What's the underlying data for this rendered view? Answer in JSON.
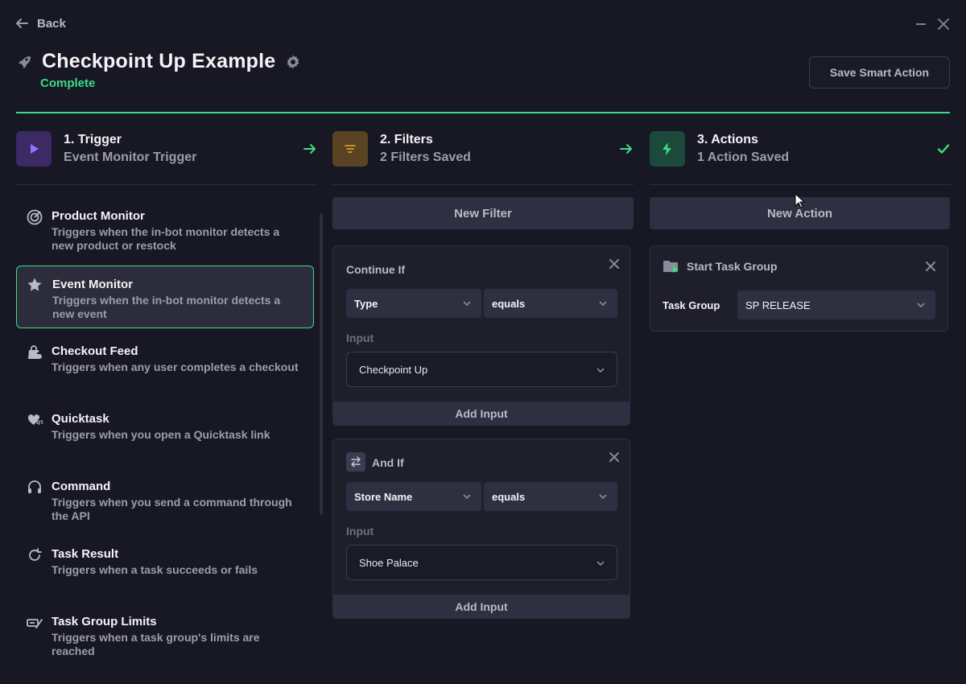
{
  "window": {
    "back_label": "Back",
    "title": "Checkpoint Up Example",
    "status": "Complete",
    "save_label": "Save Smart Action"
  },
  "colors": {
    "accent": "#3ddc84",
    "trigger": "#3b2a63",
    "filters": "#5a4322",
    "actions": "#1b4a3a"
  },
  "steps": [
    {
      "title": "1. Trigger",
      "subtitle": "Event Monitor Trigger",
      "icon": "play-icon"
    },
    {
      "title": "2. Filters",
      "subtitle": "2 Filters Saved",
      "icon": "filter-icon"
    },
    {
      "title": "3. Actions",
      "subtitle": "1 Action Saved",
      "icon": "bolt-icon"
    }
  ],
  "triggers": [
    {
      "title": "Product Monitor",
      "desc": "Triggers when the in-bot monitor detects a new product or restock",
      "icon": "target-icon"
    },
    {
      "title": "Event Monitor",
      "desc": "Triggers when the in-bot monitor detects a new event",
      "icon": "star-icon"
    },
    {
      "title": "Checkout Feed",
      "desc": "Triggers when any user completes a checkout",
      "icon": "bag-icon"
    },
    {
      "title": "Quicktask",
      "desc": "Triggers when you open a Quicktask link",
      "icon": "quicktask-icon"
    },
    {
      "title": "Command",
      "desc": "Triggers when you send a command through the API",
      "icon": "headset-icon"
    },
    {
      "title": "Task Result",
      "desc": "Triggers when a task succeeds or fails",
      "icon": "refresh-icon"
    },
    {
      "title": "Task Group Limits",
      "desc": "Triggers when a task group's limits are reached",
      "icon": "limits-icon"
    }
  ],
  "filters": {
    "new_filter_label": "New Filter",
    "cards": [
      {
        "heading": "Continue If",
        "field": "Type",
        "operator": "equals",
        "input_label": "Input",
        "input_value": "Checkpoint Up",
        "add_input_label": "Add Input"
      },
      {
        "heading": "And If",
        "field": "Store Name",
        "operator": "equals",
        "input_label": "Input",
        "input_value": "Shoe Palace",
        "add_input_label": "Add Input"
      }
    ]
  },
  "actions": {
    "new_action_label": "New Action",
    "cards": [
      {
        "heading": "Start Task Group",
        "field_label": "Task Group",
        "field_value": "SP RELEASE"
      }
    ]
  }
}
